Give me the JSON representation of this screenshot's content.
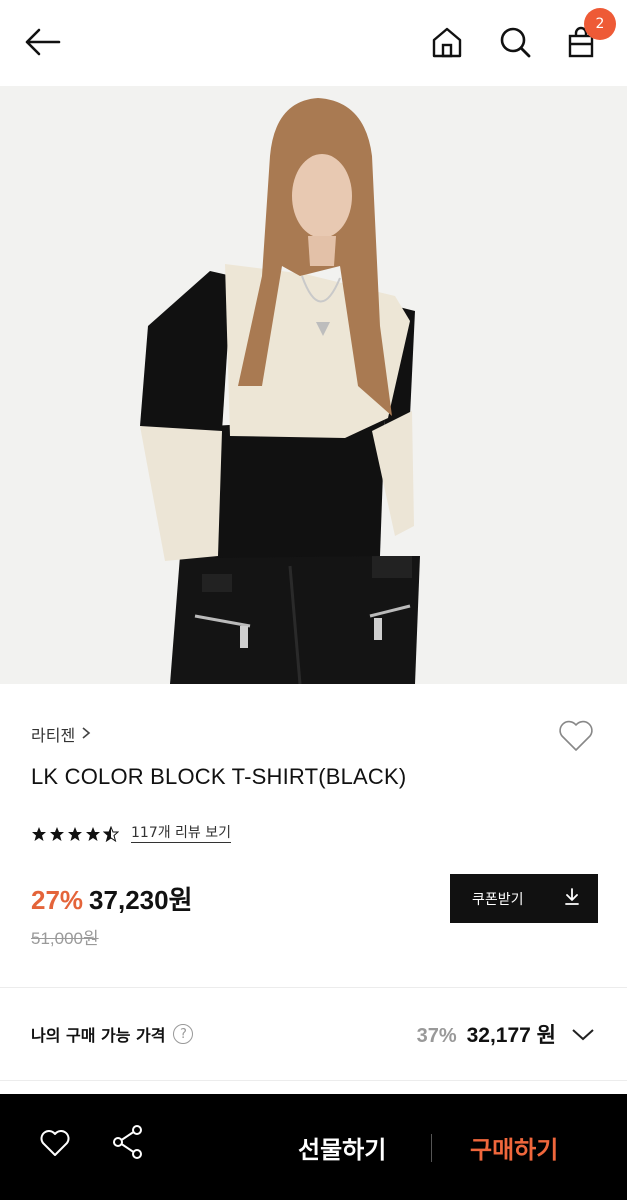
{
  "header": {
    "cart_count": "2",
    "icons": [
      "back-arrow-icon",
      "home-icon",
      "search-icon",
      "shopping-bag-icon"
    ]
  },
  "product": {
    "brand": "라티젠",
    "name": "LK COLOR BLOCK T-SHIRT(BLACK)",
    "rating": 4.5,
    "review_link": "117개 리뷰 보기",
    "discount": "27%",
    "price": "37,230원",
    "original_price": "51,000원",
    "coupon_label": "쿠폰받기"
  },
  "my_price": {
    "label": "나의 구매 가능 가격",
    "help": "?",
    "discount": "37%",
    "price": "32,177 원"
  },
  "bottom_bar": {
    "gift_label": "선물하기",
    "buy_label": "구매하기"
  },
  "colors": {
    "accent": "#e4643a",
    "badge": "#ee5a36",
    "buy": "#f0673c"
  }
}
